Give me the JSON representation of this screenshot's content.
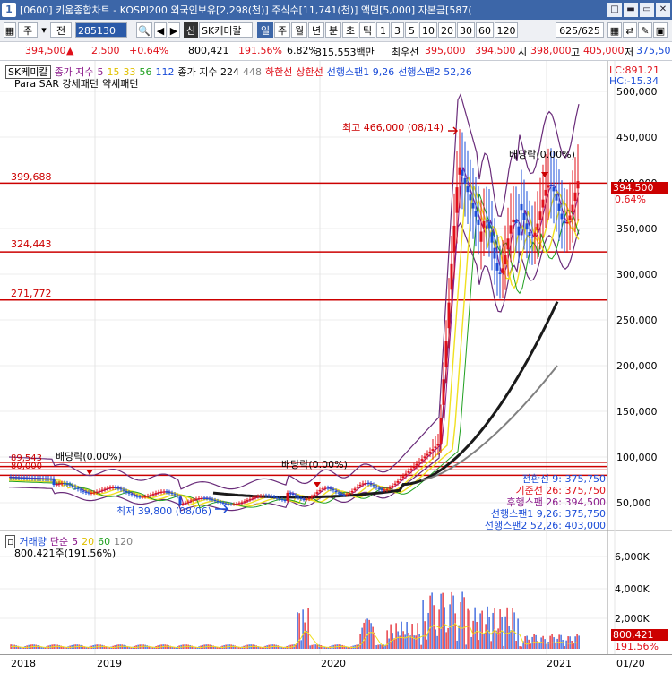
{
  "window": {
    "number": "1",
    "title": "[0600] 키움종합차트 - KOSPI200 외국인보유[2,298(천)] 주식수[11,741(천)] 액면[5,000] 자본금[587(",
    "controls": [
      "□",
      "▬",
      "▭",
      "✕"
    ]
  },
  "toolbar": {
    "market": "주",
    "market_arrow": "▾",
    "prev": "전",
    "code": "285130",
    "search_icon": "🔍",
    "nav_prev": "◀",
    "nav_next": "▶",
    "credit_badge": "신",
    "stock_name": "SK케미칼",
    "periods": [
      "일",
      "주",
      "월",
      "년",
      "분",
      "초",
      "틱"
    ],
    "selected_period": "일",
    "intervals": [
      "1",
      "3",
      "5",
      "10",
      "20",
      "30",
      "60",
      "120"
    ],
    "page_counter": "625/625",
    "right_icons": [
      "▦",
      "⇄",
      "✎",
      "▣",
      "☐",
      "⚙"
    ]
  },
  "quote": {
    "price": "394,500",
    "change_arrow": "▲",
    "change": "2,500",
    "change_pct": "+0.64%",
    "volume": "800,421",
    "volume_ratio": "191.56%",
    "turnover": "6.82%",
    "amount": "315,553백만",
    "priority_label": "최우선",
    "ask": "395,000",
    "bid": "394,500",
    "open_label": "시",
    "open": "398,000",
    "high_label": "고",
    "high": "405,000",
    "low_label": "저",
    "low": "375,50"
  },
  "price_panel": {
    "legend_line1": {
      "name": "SK케미칼",
      "ma_label": "종가 지수",
      "ma_values": [
        "5",
        "15",
        "33",
        "56",
        "112"
      ],
      "ma2_label": "종가 지수 224",
      "ma2_extra": "448",
      "lower": "하한선",
      "upper": "상한선",
      "span1": "선행스팬1 9,26",
      "span2": "선행스팬2 52,26"
    },
    "legend_line2": {
      "sar": "Para SAR 강세패턴",
      "weak": "약세패턴"
    },
    "lc_label": "LC:891.21",
    "hc_label": "HC:-15.34",
    "y_ticks": [
      "500,000",
      "450,000",
      "400,000",
      "350,000",
      "300,000",
      "250,000",
      "200,000",
      "150,000",
      "100,000",
      "50,000"
    ],
    "h_levels": [
      "399,688",
      "324,443",
      "271,772",
      "89,543",
      "80,000"
    ],
    "annotations": {
      "high": "최고 466,000 (08/14)",
      "low": "최저 39,800 (08/06)",
      "div1": "배당락(0.00%)",
      "div2": "배당락(0.00%)",
      "div3": "배당락(0.00%)"
    },
    "current_price_tag": "394,500",
    "current_pct_tag": "0.64%",
    "info_box": [
      "전환선 9: 375,750",
      "기준선 26: 375,750",
      "후행스팬 26: 394,500",
      "선행스팬1 9,26: 375,750",
      "선행스팬2 52,26: 403,000"
    ]
  },
  "volume_panel": {
    "label": "거래량",
    "ma_label": "단순",
    "ma_values": [
      "5",
      "20",
      "60",
      "120"
    ],
    "current": "800,421주(191.56%)",
    "y_ticks": [
      "6,000K",
      "4,000K",
      "2,000K"
    ],
    "tag_volume": "800,421",
    "tag_pct": "191.56%"
  },
  "x_axis": {
    "labels": [
      "2018",
      "2019",
      "2020",
      "2021",
      "01/20"
    ]
  },
  "colors": {
    "title_bg": "#3c66a8",
    "up": "#e0101a",
    "down": "#1a4cd8",
    "level_line": "#cc0000",
    "ma5": "#8b1a8b",
    "ma15": "#f0e020",
    "ma33": "#f0e020",
    "ma56": "#20a020",
    "ma112": "#1a1a1a",
    "ma224": "#808080",
    "span": "#6a2c7a"
  }
}
